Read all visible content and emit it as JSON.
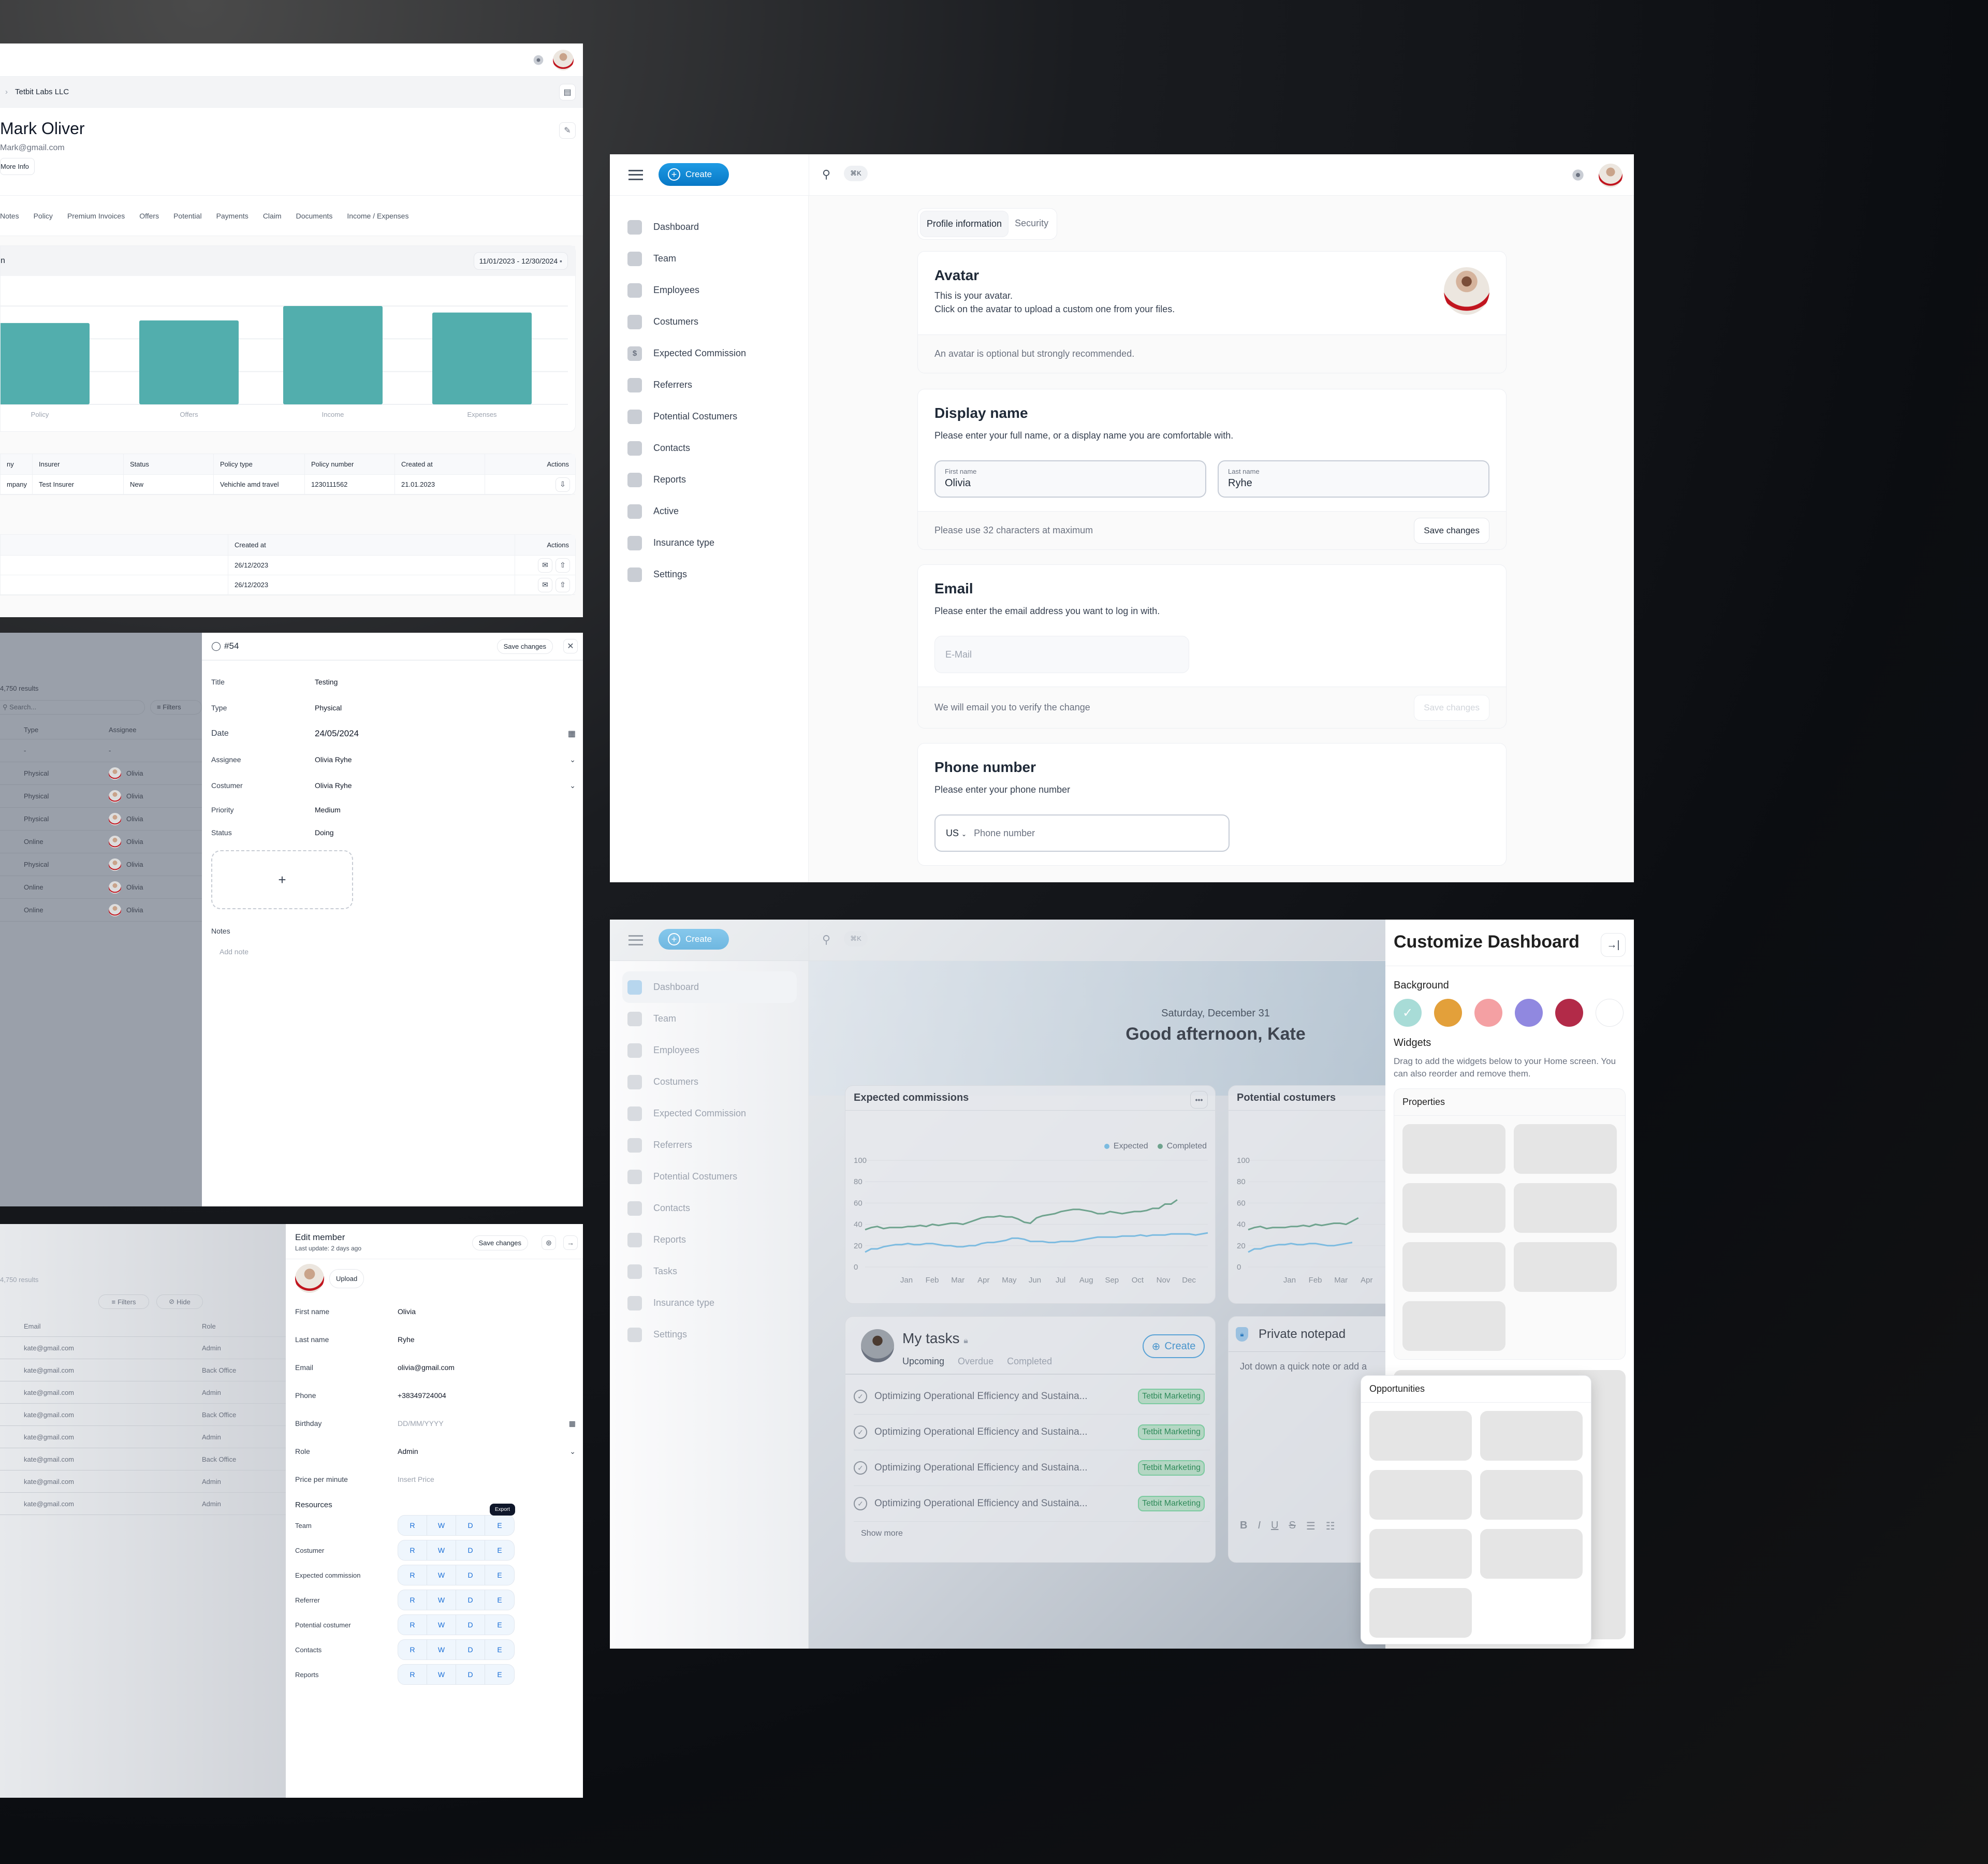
{
  "customer_panel": {
    "breadcrumb_current": "Tetbit Labs LLC",
    "name": "Mark Oliver",
    "email": "Mark@gmail.com",
    "more_info": "More Info",
    "tabs": [
      "Notes",
      "Policy",
      "Premium Invoices",
      "Offers",
      "Potential",
      "Payments",
      "Claim",
      "Documents",
      "Income / Expenses"
    ],
    "chart_header": "n",
    "date_range": "11/01/2023 - 12/30/2024",
    "policy_table": {
      "headers": [
        "ny",
        "Insurer",
        "Status",
        "Policy type",
        "Policy number",
        "Created at",
        "Actions"
      ],
      "rows": [
        [
          "mpany",
          "Test Insurer",
          "New",
          "Vehichle amd travel",
          "1230111562",
          "21.01.2023"
        ]
      ]
    },
    "docs_table": {
      "headers": [
        "Created at",
        "Actions"
      ],
      "rows": [
        [
          "26/12/2023"
        ],
        [
          "26/12/2023"
        ]
      ]
    }
  },
  "chart_data": [
    {
      "type": "bar",
      "title": "",
      "categories": [
        "Policy",
        "Offers",
        "Income",
        "Expenses"
      ],
      "values": [
        62,
        64,
        75,
        70
      ],
      "ylim": [
        0,
        90
      ],
      "grid": true,
      "color": "#52aead"
    },
    {
      "type": "line",
      "title": "Expected commissions",
      "x": [
        "Jan",
        "Feb",
        "Mar",
        "Apr",
        "May",
        "Jun",
        "Jul",
        "Aug",
        "Sep",
        "Oct",
        "Nov",
        "Dec"
      ],
      "ylim": [
        0,
        100
      ],
      "yticks": [
        0,
        20,
        40,
        60,
        80,
        100
      ],
      "legend": "top-right",
      "series": [
        {
          "name": "Expected",
          "color": "#7cbbe0",
          "values": [
            14,
            17,
            17,
            19,
            20,
            21,
            21,
            22,
            21,
            21,
            22,
            22,
            21,
            20,
            20,
            19,
            19,
            20,
            20,
            22,
            23,
            23,
            24,
            25,
            27,
            27,
            26,
            24,
            24,
            24,
            23,
            23,
            24,
            24,
            24,
            25,
            26,
            27,
            28,
            28,
            28,
            28,
            29,
            29,
            29,
            30,
            29,
            30,
            30,
            30,
            31,
            31,
            31,
            31,
            30,
            31,
            32
          ]
        },
        {
          "name": "Completed",
          "color": "#6fa38e",
          "values": [
            35,
            37,
            38,
            36,
            37,
            37,
            37,
            38,
            38,
            39,
            38,
            40,
            39,
            40,
            41,
            41,
            40,
            42,
            44,
            46,
            47,
            47,
            48,
            47,
            47,
            45,
            42,
            41,
            46,
            48,
            49,
            50,
            52,
            53,
            54,
            54,
            53,
            52,
            50,
            50,
            52,
            51,
            50,
            51,
            52,
            52,
            53,
            55,
            55,
            59,
            59,
            63
          ]
        }
      ]
    },
    {
      "type": "line",
      "title": "Potential costumers",
      "x": [
        "Jan",
        "Feb",
        "Mar",
        "Apr"
      ],
      "ylim": [
        0,
        100
      ],
      "yticks": [
        0,
        20,
        40,
        60,
        80,
        100
      ],
      "series": [
        {
          "name": "Expected",
          "color": "#7cbbe0",
          "values": [
            14,
            17,
            17,
            19,
            20,
            21,
            21,
            22,
            21,
            21,
            22,
            22,
            21,
            20,
            20,
            21,
            22,
            23
          ]
        },
        {
          "name": "Completed",
          "color": "#6fa38e",
          "values": [
            35,
            37,
            38,
            36,
            37,
            37,
            37,
            38,
            38,
            39,
            38,
            40,
            39,
            40,
            41,
            41,
            40,
            43,
            46
          ]
        }
      ]
    }
  ],
  "task_panel": {
    "results": "4,750 results",
    "search_placeholder": "Search...",
    "filters": "Filters",
    "col_type": "Type",
    "col_assignee": "Assignee",
    "rows": [
      {
        "type": "-",
        "assignee": "-"
      },
      {
        "type": "Physical",
        "assignee": "Olivia"
      },
      {
        "type": "Physical",
        "assignee": "Olivia"
      },
      {
        "type": "Physical",
        "assignee": "Olivia"
      },
      {
        "type": "Online",
        "assignee": "Olivia"
      },
      {
        "type": "Physical",
        "assignee": "Olivia"
      },
      {
        "type": "Online",
        "assignee": "Olivia"
      },
      {
        "type": "Online",
        "assignee": "Olivia"
      }
    ],
    "drawer": {
      "id": "#54",
      "save": "Save changes",
      "fields": [
        {
          "label": "Title",
          "value": "Testing"
        },
        {
          "label": "Type",
          "value": "Physical"
        },
        {
          "label": "Date",
          "value": "24/05/2024"
        },
        {
          "label": "Assignee",
          "value": "Olivia Ryhe"
        },
        {
          "label": "Costumer",
          "value": "Olivia Ryhe"
        },
        {
          "label": "Priority",
          "value": "Medium"
        },
        {
          "label": "Status",
          "value": "Doing"
        }
      ],
      "notes_label": "Notes",
      "notes_placeholder": "Add note"
    }
  },
  "member_panel": {
    "results": "4,750 results",
    "filters": "Filters",
    "hide": "Hide",
    "col_email": "Email",
    "col_role": "Role",
    "rows": [
      {
        "email": "kate@gmail.com",
        "role": "Admin"
      },
      {
        "email": "kate@gmail.com",
        "role": "Back Office"
      },
      {
        "email": "kate@gmail.com",
        "role": "Admin"
      },
      {
        "email": "kate@gmail.com",
        "role": "Back Office"
      },
      {
        "email": "kate@gmail.com",
        "role": "Admin"
      },
      {
        "email": "kate@gmail.com",
        "role": "Back Office"
      },
      {
        "email": "kate@gmail.com",
        "role": "Admin"
      },
      {
        "email": "kate@gmail.com",
        "role": "Admin"
      }
    ],
    "drawer": {
      "title": "Edit member",
      "subtitle": "Last update: 2 days ago",
      "save": "Save changes",
      "upload": "Upload",
      "fields": [
        {
          "label": "First name",
          "value": "Olivia"
        },
        {
          "label": "Last name",
          "value": "Ryhe"
        },
        {
          "label": "Email",
          "value": "olivia@gmail.com"
        },
        {
          "label": "Phone",
          "value": "+38349724004"
        }
      ],
      "birthday_label": "Birthday",
      "birthday_placeholder": "DD/MM/YYYY",
      "role_label": "Role",
      "role_value": "Admin",
      "price_label": "Price per minute",
      "price_placeholder": "Insert Price",
      "resources_title": "Resources",
      "tooltip": "Export",
      "perm_letters": [
        "R",
        "W",
        "D",
        "E"
      ],
      "resources": [
        "Team",
        "Costumer",
        "Expected commission",
        "Referrer",
        "Potential costumer",
        "Contacts",
        "Reports"
      ]
    }
  },
  "profile_panel": {
    "create": "Create",
    "shortcut": "⌘K",
    "nav": [
      {
        "label": "Dashboard",
        "icon": "dashboard-icon"
      },
      {
        "label": "Team",
        "icon": "team-icon"
      },
      {
        "label": "Employees",
        "icon": "employees-icon"
      },
      {
        "label": "Costumers",
        "icon": "costumers-icon"
      },
      {
        "label": "Expected Commission",
        "icon": "commission-icon"
      },
      {
        "label": "Referrers",
        "icon": "referrers-icon"
      },
      {
        "label": "Potential Costumers",
        "icon": "inbox-icon"
      },
      {
        "label": "Contacts",
        "icon": "contacts-icon"
      },
      {
        "label": "Reports",
        "icon": "reports-icon"
      },
      {
        "label": "Active",
        "icon": "active-icon"
      },
      {
        "label": "Insurance type",
        "icon": "insurance-icon"
      },
      {
        "label": "Settings",
        "icon": "settings-icon"
      }
    ],
    "tabs": [
      "Profile information",
      "Security"
    ],
    "avatar": {
      "title": "Avatar",
      "line1": "This is your avatar.",
      "line2": "Click on the avatar to upload a custom one from your files.",
      "footer": "An avatar is optional but strongly recommended."
    },
    "display_name": {
      "title": "Display name",
      "desc": "Please enter your full name, or a display name you are comfortable with.",
      "first_label": "First name",
      "first_value": "Olivia",
      "last_label": "Last name",
      "last_value": "Ryhe",
      "footer": "Please use 32 characters at maximum",
      "save": "Save changes"
    },
    "email": {
      "title": "Email",
      "desc": "Please enter the email address you want to log in with.",
      "placeholder": "E-Mail",
      "footer": "We will email you to verify the change",
      "save": "Save changes"
    },
    "phone": {
      "title": "Phone number",
      "desc": "Please enter your phone number",
      "country": "US",
      "placeholder": "Phone number"
    }
  },
  "dashboard_panel": {
    "create": "Create",
    "shortcut": "⌘K",
    "nav": [
      "Dashboard",
      "Team",
      "Employees",
      "Costumers",
      "Expected Commission",
      "Referrers",
      "Potential Costumers",
      "Contacts",
      "Reports",
      "Tasks",
      "Insurance type",
      "Settings"
    ],
    "date": "Saturday, December 31",
    "greeting": "Good afternoon, Kate",
    "widget_commissions": "Expected commissions",
    "widget_potential": "Potential costumers",
    "legend_expected": "Expected",
    "legend_completed": "Completed",
    "tasks": {
      "title": "My tasks",
      "tabs": [
        "Upcoming",
        "Overdue",
        "Completed"
      ],
      "create": "Create",
      "items": [
        {
          "text": "Optimizing Operational Efficiency and Sustaina...",
          "tag": "Tetbit Marketing"
        },
        {
          "text": "Optimizing Operational Efficiency and Sustaina...",
          "tag": "Tetbit Marketing"
        },
        {
          "text": "Optimizing Operational Efficiency and Sustaina...",
          "tag": "Tetbit Marketing"
        },
        {
          "text": "Optimizing Operational Efficiency and Sustaina...",
          "tag": "Tetbit Marketing"
        }
      ],
      "show_more": "Show more"
    },
    "notepad": {
      "title": "Private notepad",
      "placeholder": "Jot down a quick note or add a"
    },
    "customize": {
      "title": "Customize Dashboard",
      "background_label": "Background",
      "swatches": [
        "#a8dcd7",
        "#e3a03a",
        "#f4a0a3",
        "#9088e0",
        "#b22a48",
        "#ffffff"
      ],
      "selected_swatch": 0,
      "widgets_label": "Widgets",
      "widgets_desc": "Drag to add the widgets below to your Home screen. You can also reorder and remove them.",
      "properties": "Properties",
      "opportunities": "Opportunities"
    }
  }
}
